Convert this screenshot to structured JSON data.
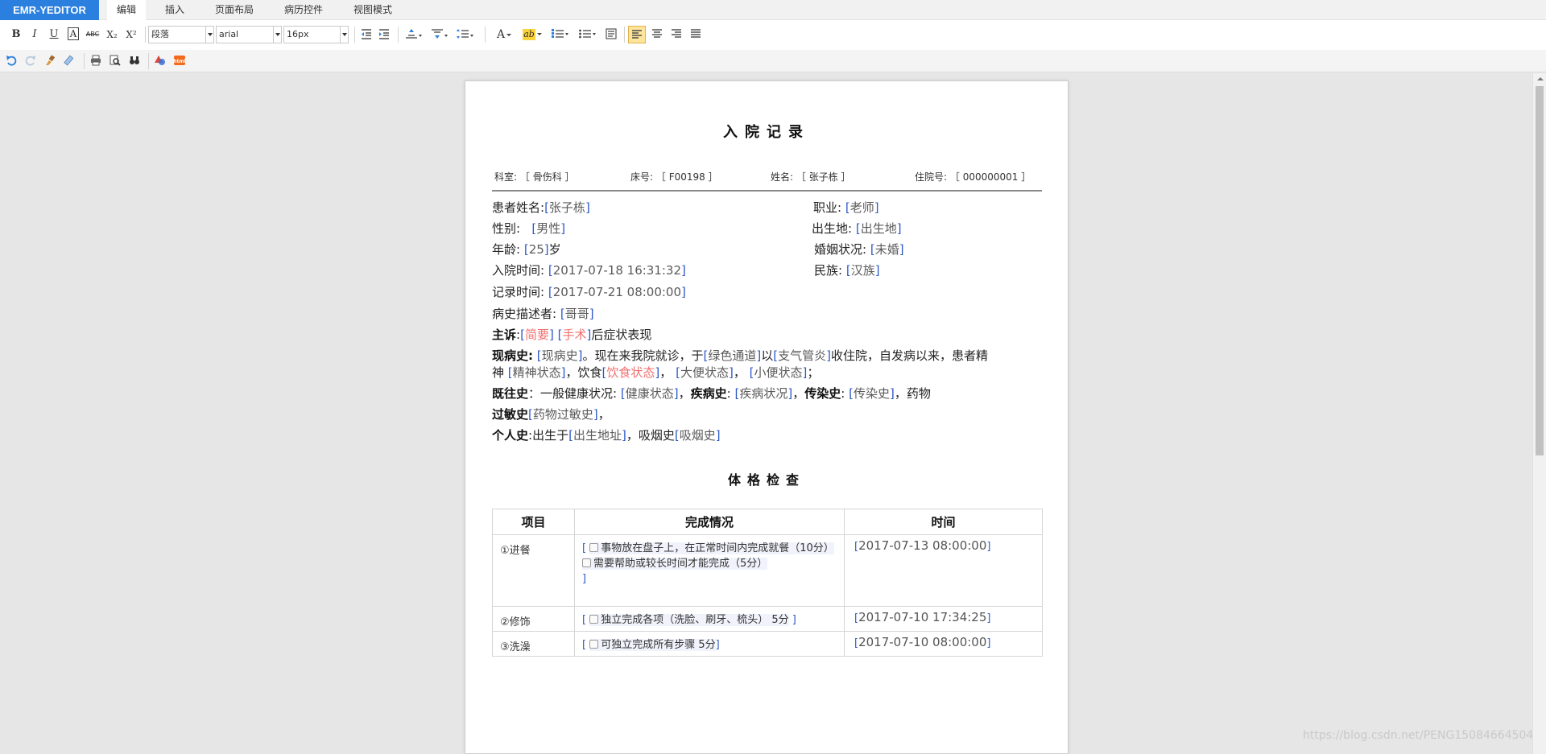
{
  "app": {
    "brand": "EMR-YEDITOR"
  },
  "menu": {
    "tabs": [
      {
        "label": "编辑",
        "active": true
      },
      {
        "label": "插入",
        "active": false
      },
      {
        "label": "页面布局",
        "active": false
      },
      {
        "label": "病历控件",
        "active": false
      },
      {
        "label": "视图模式",
        "active": false
      }
    ]
  },
  "toolbar": {
    "bold": "B",
    "italic": "I",
    "underline": "U",
    "char_border": "A",
    "strike": "ABC",
    "subscript": "X₂",
    "superscript": "X²",
    "paragraph_select": "段落",
    "font_select": "arial",
    "size_select": "16px",
    "font_color": "A",
    "highlight": "ab",
    "active_align": "left"
  },
  "document": {
    "title": "入院记录",
    "header": {
      "dept_label": "科室:",
      "dept_value": "骨伤科",
      "bed_label": "床号:",
      "bed_value": "F00198",
      "name_label": "姓名:",
      "name_value": "张子栋",
      "hosp_label": "住院号:",
      "hosp_value": "000000001"
    },
    "fields": {
      "patient_name_label": "患者姓名:",
      "patient_name": "张子栋",
      "job_label": "职业:",
      "job": "老师",
      "gender_label": "性别:",
      "gender": "男性",
      "birthplace_label": "出生地:",
      "birthplace": "出生地",
      "age_label": "年龄:",
      "age": "25",
      "age_unit": "岁",
      "marital_label": "婚姻状况:",
      "marital": "未婚",
      "admit_label": "入院时间:",
      "admit_time": "2017-07-18 16:31:32",
      "nation_label": "民族:",
      "nation": "汉族",
      "record_label": "记录时间:",
      "record_time": "2017-07-21 08:00:00",
      "narrator_label": "病史描述者:",
      "narrator": "哥哥"
    },
    "complaint": {
      "label": "主诉",
      "f1": "简要",
      "f2": "手术",
      "suffix": "后症状表现"
    },
    "present": {
      "label": "现病史:",
      "f1": "现病史",
      "t1": "。现在来我院就诊，于",
      "f2": "绿色通道",
      "t2": "以",
      "f3": "支气管炎",
      "t3": "收住院，自发病以来，患者精",
      "t4": "神",
      "f4": "精神状态",
      "t5": "，饮食",
      "f5": "饮食状态",
      "t6": "，",
      "f6": "大便状态",
      "t7": "，",
      "f7": "小便状态",
      "t8": "；"
    },
    "past": {
      "label": "既往史",
      "t1": "：一般健康状况:",
      "f1": "健康状态",
      "t2": "，",
      "disease_label": "疾病史",
      "t3": ":",
      "f2": "疾病状况",
      "t4": "，",
      "infect_label": "传染史",
      "t5": ":",
      "f3": "传染史",
      "t6": "，药物"
    },
    "allergy": {
      "label": "过敏史",
      "f1": "药物过敏史",
      "t1": "，"
    },
    "personal": {
      "label": "个人史",
      "t1": ":出生于",
      "f1": "出生地址",
      "t2": "，吸烟史",
      "f2": "吸烟史"
    },
    "exam": {
      "title": "体格检查",
      "headers": [
        "项目",
        "完成情况",
        "时间"
      ],
      "rows": [
        {
          "item": "①进餐",
          "opt1": "事物放在盘子上，在正常时间内完成就餐（10分）",
          "opt2": "需要帮助或较长时间才能完成（5分）",
          "time": "2017-07-13 08:00:00"
        },
        {
          "item": "②修饰",
          "opt1": "独立完成各项（洗脸、刷牙、梳头） 5分",
          "time": "2017-07-10 17:34:25"
        },
        {
          "item": "③洗澡",
          "opt1": "可独立完成所有步骤 5分",
          "time": "2017-07-10 08:00:00"
        }
      ]
    }
  },
  "watermark": "https://blog.csdn.net/PENG15084664504"
}
